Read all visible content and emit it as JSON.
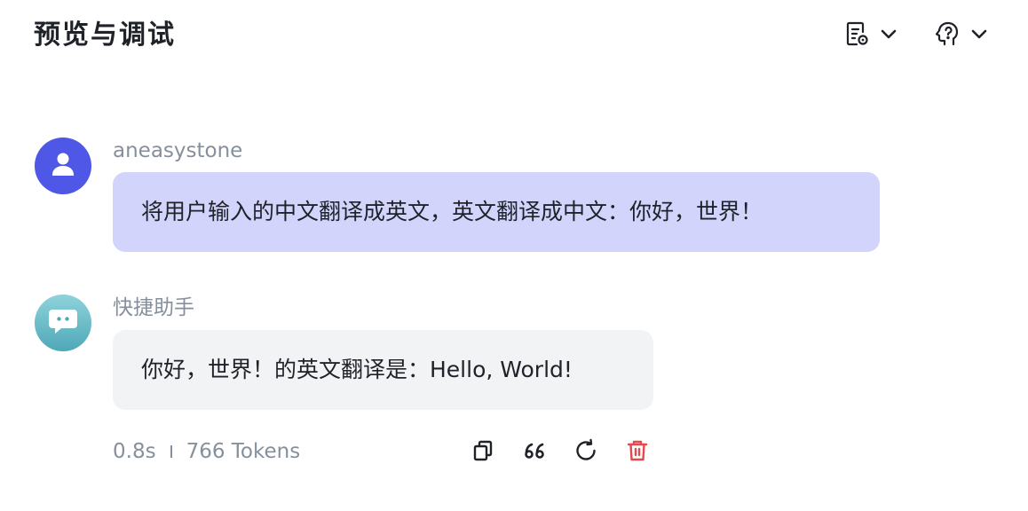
{
  "header": {
    "title": "预览与调试",
    "actions": [
      {
        "icon": "document-settings-icon"
      },
      {
        "icon": "brain-idea-icon"
      }
    ]
  },
  "messages": [
    {
      "role": "user",
      "sender": "aneasystone",
      "text": "将用户输入的中文翻译成英文，英文翻译成中文：你好，世界！",
      "avatar_icon": "user-icon",
      "bubble_color": "#d2d4fc"
    },
    {
      "role": "assistant",
      "sender": "快捷助手",
      "text": "你好，世界！的英文翻译是：Hello, World!",
      "avatar_icon": "chat-bubble-icon",
      "bubble_color": "#f2f3f5"
    }
  ],
  "meta": {
    "latency": "0.8s",
    "tokens": "766 Tokens"
  },
  "message_actions": [
    {
      "icon": "copy-icon"
    },
    {
      "icon": "quote-icon"
    },
    {
      "icon": "regenerate-icon"
    },
    {
      "icon": "delete-icon",
      "color": "#e5484d"
    }
  ],
  "colors": {
    "accent": "#4e57e6",
    "muted_text": "#86909c",
    "danger": "#e5484d"
  }
}
